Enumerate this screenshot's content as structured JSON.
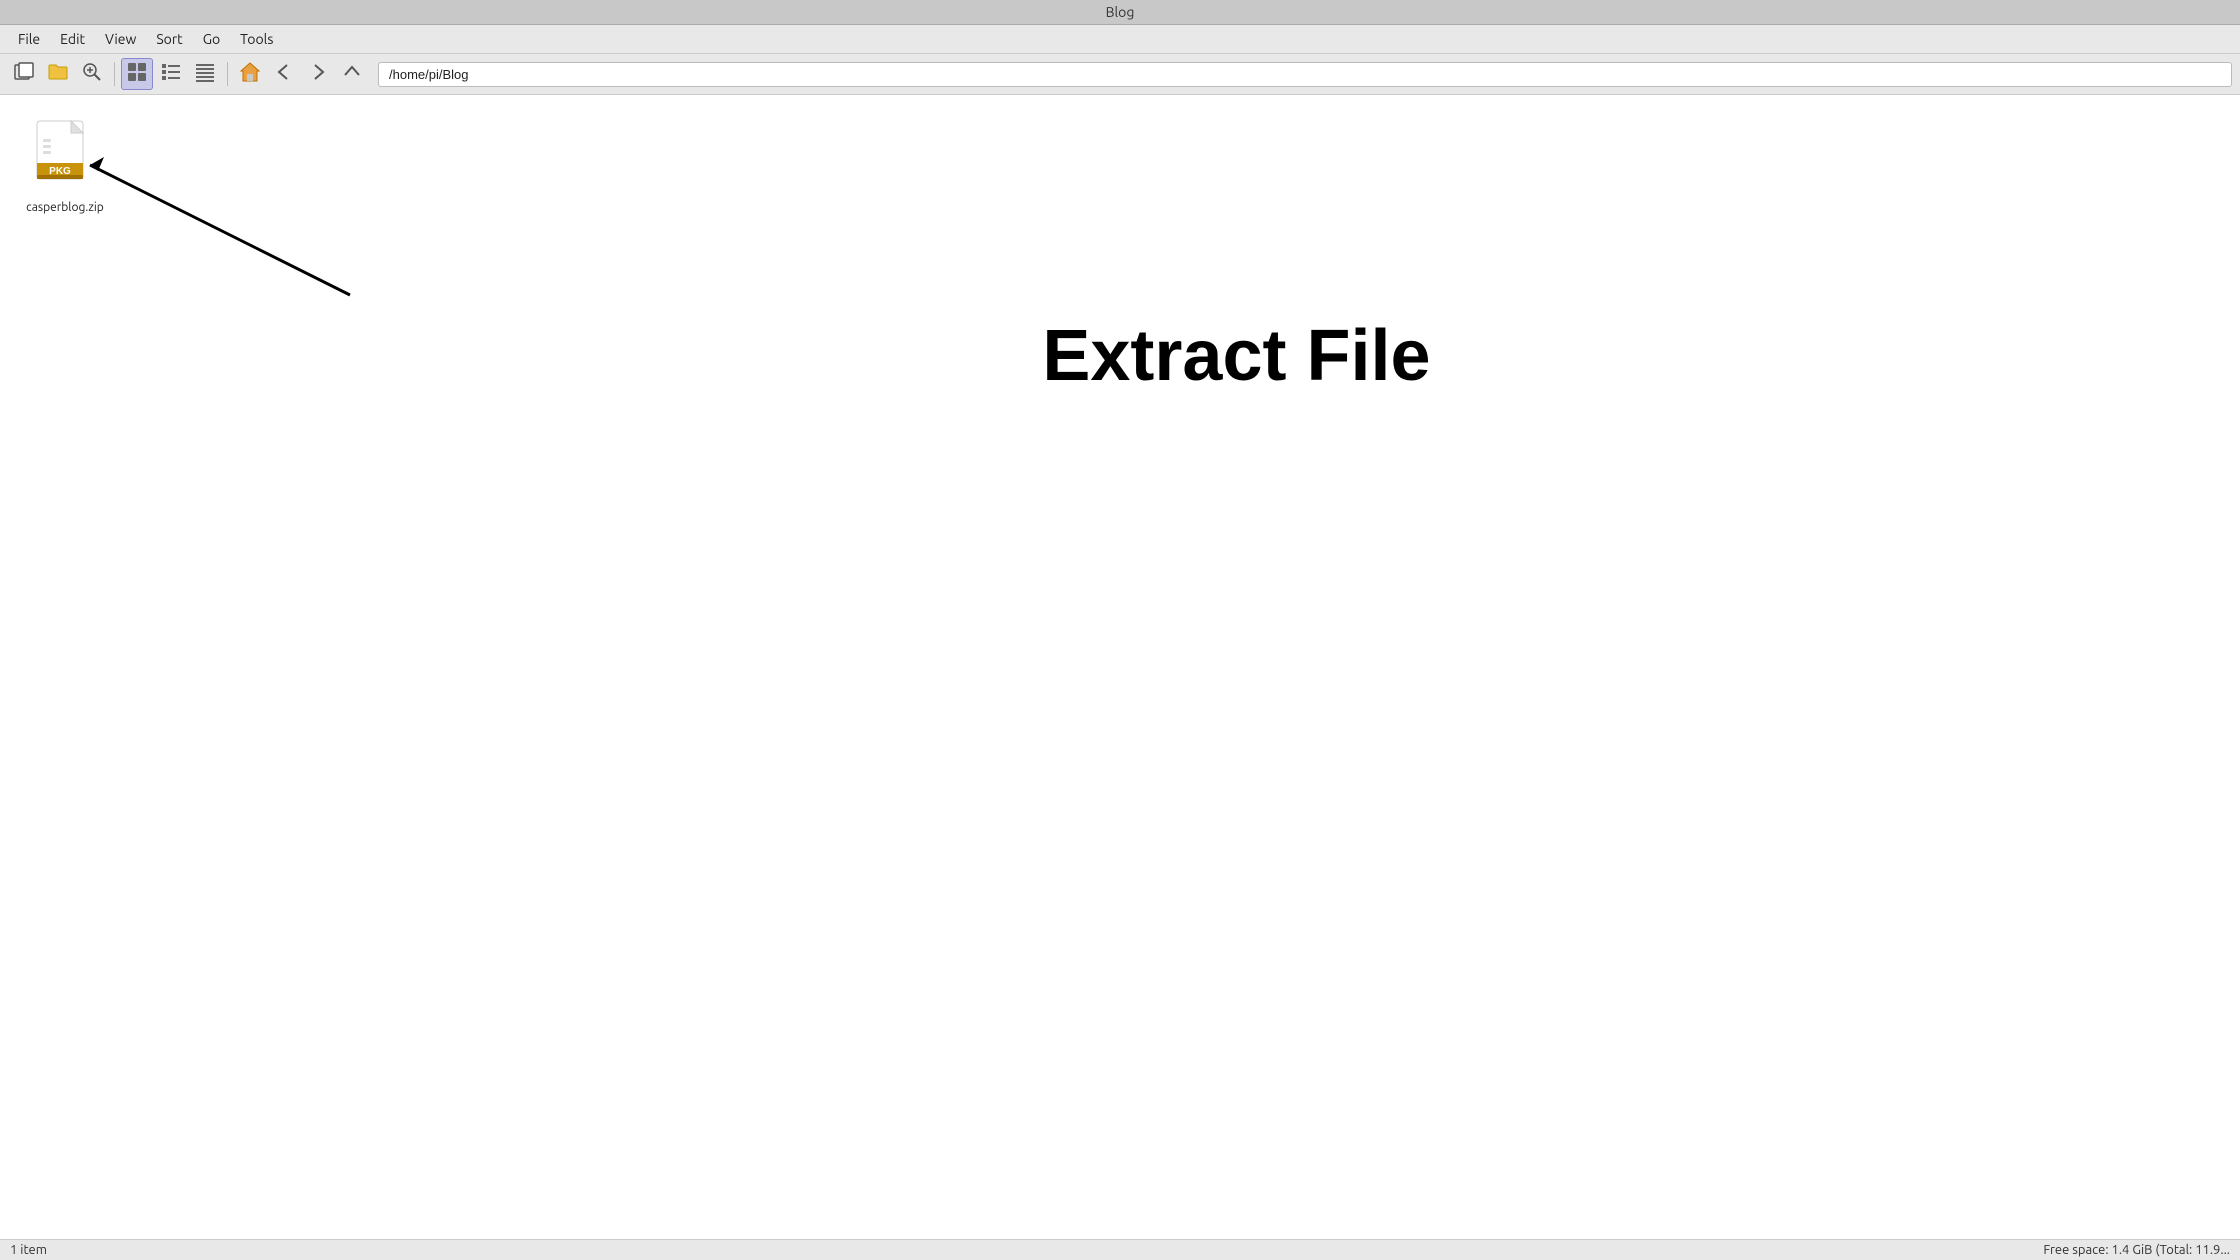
{
  "title_bar": {
    "title": "Blog"
  },
  "menu_bar": {
    "items": [
      "File",
      "Edit",
      "View",
      "Sort",
      "Go",
      "Tools"
    ]
  },
  "toolbar": {
    "address": "/home/pi/Blog"
  },
  "file": {
    "name": "casperblog.zip",
    "icon_label": "PKG"
  },
  "annotation": {
    "extract_label": "Extract File"
  },
  "status_bar": {
    "left": "1 item",
    "right": "Free space: 1.4 GiB (Total: 11.9..."
  }
}
